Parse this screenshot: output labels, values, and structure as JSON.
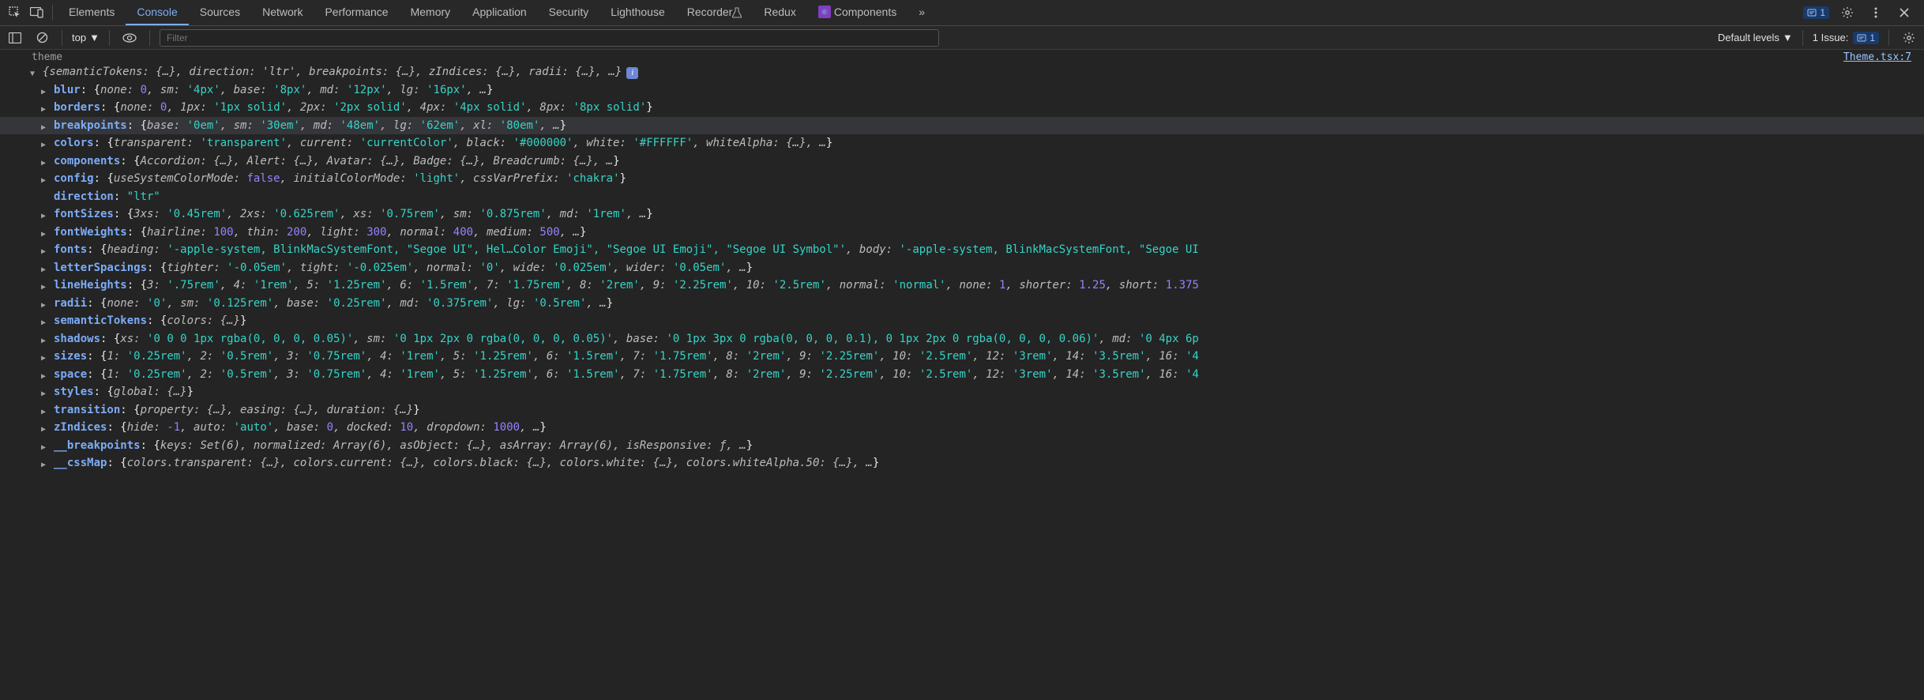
{
  "toolbar": {
    "tabs": [
      "Elements",
      "Console",
      "Sources",
      "Network",
      "Performance",
      "Memory",
      "Application",
      "Security",
      "Lighthouse",
      "Recorder",
      "Redux",
      "Components"
    ],
    "active_tab": "Console",
    "recorder_flask": true,
    "more_tabs_icon": "»",
    "message_count": "1"
  },
  "subbar": {
    "context": "top",
    "filter_placeholder": "Filter",
    "levels": "Default levels",
    "issues_label": "1 Issue:",
    "issues_count": "1"
  },
  "source_link": "Theme.tsx:7",
  "console": {
    "root_label": "theme",
    "summary": "{semanticTokens: {…}, direction: 'ltr', breakpoints: {…}, zIndices: {…}, radii: {…}, …}",
    "entries": [
      {
        "key": "blur",
        "tokens": [
          [
            "p",
            "{"
          ],
          [
            "g",
            "none: "
          ],
          [
            "n",
            "0"
          ],
          [
            "g",
            ", sm: "
          ],
          [
            "s",
            "'4px'"
          ],
          [
            "g",
            ", base: "
          ],
          [
            "s",
            "'8px'"
          ],
          [
            "g",
            ", md: "
          ],
          [
            "s",
            "'12px'"
          ],
          [
            "g",
            ", lg: "
          ],
          [
            "s",
            "'16px'"
          ],
          [
            "g",
            ", …"
          ],
          [
            "p",
            "}"
          ]
        ]
      },
      {
        "key": "borders",
        "tokens": [
          [
            "p",
            "{"
          ],
          [
            "g",
            "none: "
          ],
          [
            "n",
            "0"
          ],
          [
            "g",
            ", 1px: "
          ],
          [
            "s",
            "'1px solid'"
          ],
          [
            "g",
            ", 2px: "
          ],
          [
            "s",
            "'2px solid'"
          ],
          [
            "g",
            ", 4px: "
          ],
          [
            "s",
            "'4px solid'"
          ],
          [
            "g",
            ", 8px: "
          ],
          [
            "s",
            "'8px solid'"
          ],
          [
            "p",
            "}"
          ]
        ]
      },
      {
        "key": "breakpoints",
        "highlight": true,
        "tokens": [
          [
            "p",
            "{"
          ],
          [
            "g",
            "base: "
          ],
          [
            "s",
            "'0em'"
          ],
          [
            "g",
            ", sm: "
          ],
          [
            "s",
            "'30em'"
          ],
          [
            "g",
            ", md: "
          ],
          [
            "s",
            "'48em'"
          ],
          [
            "g",
            ", lg: "
          ],
          [
            "s",
            "'62em'"
          ],
          [
            "g",
            ", xl: "
          ],
          [
            "s",
            "'80em'"
          ],
          [
            "g",
            ", …"
          ],
          [
            "p",
            "}"
          ]
        ]
      },
      {
        "key": "colors",
        "tokens": [
          [
            "p",
            "{"
          ],
          [
            "g",
            "transparent: "
          ],
          [
            "s",
            "'transparent'"
          ],
          [
            "g",
            ", current: "
          ],
          [
            "s",
            "'currentColor'"
          ],
          [
            "g",
            ", black: "
          ],
          [
            "s",
            "'#000000'"
          ],
          [
            "g",
            ", white: "
          ],
          [
            "s",
            "'#FFFFFF'"
          ],
          [
            "g",
            ", whiteAlpha: "
          ],
          [
            "ell",
            "{…}"
          ],
          [
            "g",
            ", …"
          ],
          [
            "p",
            "}"
          ]
        ]
      },
      {
        "key": "components",
        "tokens": [
          [
            "p",
            "{"
          ],
          [
            "g",
            "Accordion: "
          ],
          [
            "ell",
            "{…}"
          ],
          [
            "g",
            ", Alert: "
          ],
          [
            "ell",
            "{…}"
          ],
          [
            "g",
            ", Avatar: "
          ],
          [
            "ell",
            "{…}"
          ],
          [
            "g",
            ", Badge: "
          ],
          [
            "ell",
            "{…}"
          ],
          [
            "g",
            ", Breadcrumb: "
          ],
          [
            "ell",
            "{…}"
          ],
          [
            "g",
            ", …"
          ],
          [
            "p",
            "}"
          ]
        ]
      },
      {
        "key": "config",
        "tokens": [
          [
            "p",
            "{"
          ],
          [
            "g",
            "useSystemColorMode: "
          ],
          [
            "b",
            "false"
          ],
          [
            "g",
            ", initialColorMode: "
          ],
          [
            "s",
            "'light'"
          ],
          [
            "g",
            ", cssVarPrefix: "
          ],
          [
            "s",
            "'chakra'"
          ],
          [
            "p",
            "}"
          ]
        ]
      },
      {
        "key": "direction",
        "noarrow": true,
        "tokens": [
          [
            "s",
            "\"ltr\""
          ]
        ]
      },
      {
        "key": "fontSizes",
        "tokens": [
          [
            "p",
            "{"
          ],
          [
            "g",
            "3xs: "
          ],
          [
            "s",
            "'0.45rem'"
          ],
          [
            "g",
            ", 2xs: "
          ],
          [
            "s",
            "'0.625rem'"
          ],
          [
            "g",
            ", xs: "
          ],
          [
            "s",
            "'0.75rem'"
          ],
          [
            "g",
            ", sm: "
          ],
          [
            "s",
            "'0.875rem'"
          ],
          [
            "g",
            ", md: "
          ],
          [
            "s",
            "'1rem'"
          ],
          [
            "g",
            ", …"
          ],
          [
            "p",
            "}"
          ]
        ]
      },
      {
        "key": "fontWeights",
        "tokens": [
          [
            "p",
            "{"
          ],
          [
            "g",
            "hairline: "
          ],
          [
            "n",
            "100"
          ],
          [
            "g",
            ", thin: "
          ],
          [
            "n",
            "200"
          ],
          [
            "g",
            ", light: "
          ],
          [
            "n",
            "300"
          ],
          [
            "g",
            ", normal: "
          ],
          [
            "n",
            "400"
          ],
          [
            "g",
            ", medium: "
          ],
          [
            "n",
            "500"
          ],
          [
            "g",
            ", …"
          ],
          [
            "p",
            "}"
          ]
        ]
      },
      {
        "key": "fonts",
        "tokens": [
          [
            "p",
            "{"
          ],
          [
            "g",
            "heading: "
          ],
          [
            "s",
            "'-apple-system, BlinkMacSystemFont, \"Segoe UI\", Hel…Color Emoji\", \"Segoe UI Emoji\", \"Segoe UI Symbol\"'"
          ],
          [
            "g",
            ", body: "
          ],
          [
            "s",
            "'-apple-system, BlinkMacSystemFont, \"Segoe UI"
          ]
        ]
      },
      {
        "key": "letterSpacings",
        "tokens": [
          [
            "p",
            "{"
          ],
          [
            "g",
            "tighter: "
          ],
          [
            "s",
            "'-0.05em'"
          ],
          [
            "g",
            ", tight: "
          ],
          [
            "s",
            "'-0.025em'"
          ],
          [
            "g",
            ", normal: "
          ],
          [
            "s",
            "'0'"
          ],
          [
            "g",
            ", wide: "
          ],
          [
            "s",
            "'0.025em'"
          ],
          [
            "g",
            ", wider: "
          ],
          [
            "s",
            "'0.05em'"
          ],
          [
            "g",
            ", …"
          ],
          [
            "p",
            "}"
          ]
        ]
      },
      {
        "key": "lineHeights",
        "tokens": [
          [
            "p",
            "{"
          ],
          [
            "g",
            "3: "
          ],
          [
            "s",
            "'.75rem'"
          ],
          [
            "g",
            ", 4: "
          ],
          [
            "s",
            "'1rem'"
          ],
          [
            "g",
            ", 5: "
          ],
          [
            "s",
            "'1.25rem'"
          ],
          [
            "g",
            ", 6: "
          ],
          [
            "s",
            "'1.5rem'"
          ],
          [
            "g",
            ", 7: "
          ],
          [
            "s",
            "'1.75rem'"
          ],
          [
            "g",
            ", 8: "
          ],
          [
            "s",
            "'2rem'"
          ],
          [
            "g",
            ", 9: "
          ],
          [
            "s",
            "'2.25rem'"
          ],
          [
            "g",
            ", 10: "
          ],
          [
            "s",
            "'2.5rem'"
          ],
          [
            "g",
            ", normal: "
          ],
          [
            "s",
            "'normal'"
          ],
          [
            "g",
            ", none: "
          ],
          [
            "n",
            "1"
          ],
          [
            "g",
            ", shorter: "
          ],
          [
            "n",
            "1.25"
          ],
          [
            "g",
            ", short: "
          ],
          [
            "n",
            "1.375"
          ]
        ]
      },
      {
        "key": "radii",
        "tokens": [
          [
            "p",
            "{"
          ],
          [
            "g",
            "none: "
          ],
          [
            "s",
            "'0'"
          ],
          [
            "g",
            ", sm: "
          ],
          [
            "s",
            "'0.125rem'"
          ],
          [
            "g",
            ", base: "
          ],
          [
            "s",
            "'0.25rem'"
          ],
          [
            "g",
            ", md: "
          ],
          [
            "s",
            "'0.375rem'"
          ],
          [
            "g",
            ", lg: "
          ],
          [
            "s",
            "'0.5rem'"
          ],
          [
            "g",
            ", …"
          ],
          [
            "p",
            "}"
          ]
        ]
      },
      {
        "key": "semanticTokens",
        "tokens": [
          [
            "p",
            "{"
          ],
          [
            "g",
            "colors: "
          ],
          [
            "ell",
            "{…}"
          ],
          [
            "p",
            "}"
          ]
        ]
      },
      {
        "key": "shadows",
        "tokens": [
          [
            "p",
            "{"
          ],
          [
            "g",
            "xs: "
          ],
          [
            "s",
            "'0 0 0 1px rgba(0, 0, 0, 0.05)'"
          ],
          [
            "g",
            ", sm: "
          ],
          [
            "s",
            "'0 1px 2px 0 rgba(0, 0, 0, 0.05)'"
          ],
          [
            "g",
            ", base: "
          ],
          [
            "s",
            "'0 1px 3px 0 rgba(0, 0, 0, 0.1), 0 1px 2px 0 rgba(0, 0, 0, 0.06)'"
          ],
          [
            "g",
            ", md: "
          ],
          [
            "s",
            "'0 4px 6p"
          ]
        ]
      },
      {
        "key": "sizes",
        "tokens": [
          [
            "p",
            "{"
          ],
          [
            "g",
            "1: "
          ],
          [
            "s",
            "'0.25rem'"
          ],
          [
            "g",
            ", 2: "
          ],
          [
            "s",
            "'0.5rem'"
          ],
          [
            "g",
            ", 3: "
          ],
          [
            "s",
            "'0.75rem'"
          ],
          [
            "g",
            ", 4: "
          ],
          [
            "s",
            "'1rem'"
          ],
          [
            "g",
            ", 5: "
          ],
          [
            "s",
            "'1.25rem'"
          ],
          [
            "g",
            ", 6: "
          ],
          [
            "s",
            "'1.5rem'"
          ],
          [
            "g",
            ", 7: "
          ],
          [
            "s",
            "'1.75rem'"
          ],
          [
            "g",
            ", 8: "
          ],
          [
            "s",
            "'2rem'"
          ],
          [
            "g",
            ", 9: "
          ],
          [
            "s",
            "'2.25rem'"
          ],
          [
            "g",
            ", 10: "
          ],
          [
            "s",
            "'2.5rem'"
          ],
          [
            "g",
            ", 12: "
          ],
          [
            "s",
            "'3rem'"
          ],
          [
            "g",
            ", 14: "
          ],
          [
            "s",
            "'3.5rem'"
          ],
          [
            "g",
            ", 16: "
          ],
          [
            "s",
            "'4"
          ]
        ]
      },
      {
        "key": "space",
        "tokens": [
          [
            "p",
            "{"
          ],
          [
            "g",
            "1: "
          ],
          [
            "s",
            "'0.25rem'"
          ],
          [
            "g",
            ", 2: "
          ],
          [
            "s",
            "'0.5rem'"
          ],
          [
            "g",
            ", 3: "
          ],
          [
            "s",
            "'0.75rem'"
          ],
          [
            "g",
            ", 4: "
          ],
          [
            "s",
            "'1rem'"
          ],
          [
            "g",
            ", 5: "
          ],
          [
            "s",
            "'1.25rem'"
          ],
          [
            "g",
            ", 6: "
          ],
          [
            "s",
            "'1.5rem'"
          ],
          [
            "g",
            ", 7: "
          ],
          [
            "s",
            "'1.75rem'"
          ],
          [
            "g",
            ", 8: "
          ],
          [
            "s",
            "'2rem'"
          ],
          [
            "g",
            ", 9: "
          ],
          [
            "s",
            "'2.25rem'"
          ],
          [
            "g",
            ", 10: "
          ],
          [
            "s",
            "'2.5rem'"
          ],
          [
            "g",
            ", 12: "
          ],
          [
            "s",
            "'3rem'"
          ],
          [
            "g",
            ", 14: "
          ],
          [
            "s",
            "'3.5rem'"
          ],
          [
            "g",
            ", 16: "
          ],
          [
            "s",
            "'4"
          ]
        ]
      },
      {
        "key": "styles",
        "tokens": [
          [
            "p",
            "{"
          ],
          [
            "g",
            "global: "
          ],
          [
            "ell",
            "{…}"
          ],
          [
            "p",
            "}"
          ]
        ]
      },
      {
        "key": "transition",
        "tokens": [
          [
            "p",
            "{"
          ],
          [
            "g",
            "property: "
          ],
          [
            "ell",
            "{…}"
          ],
          [
            "g",
            ", easing: "
          ],
          [
            "ell",
            "{…}"
          ],
          [
            "g",
            ", duration: "
          ],
          [
            "ell",
            "{…}"
          ],
          [
            "p",
            "}"
          ]
        ]
      },
      {
        "key": "zIndices",
        "tokens": [
          [
            "p",
            "{"
          ],
          [
            "g",
            "hide: "
          ],
          [
            "n",
            "-1"
          ],
          [
            "g",
            ", auto: "
          ],
          [
            "s",
            "'auto'"
          ],
          [
            "g",
            ", base: "
          ],
          [
            "n",
            "0"
          ],
          [
            "g",
            ", docked: "
          ],
          [
            "n",
            "10"
          ],
          [
            "g",
            ", dropdown: "
          ],
          [
            "n",
            "1000"
          ],
          [
            "g",
            ", …"
          ],
          [
            "p",
            "}"
          ]
        ]
      },
      {
        "key": "__breakpoints",
        "tokens": [
          [
            "p",
            "{"
          ],
          [
            "g",
            "keys: "
          ],
          [
            "fn",
            "Set(6)"
          ],
          [
            "g",
            ", normalized: "
          ],
          [
            "fn",
            "Array(6)"
          ],
          [
            "g",
            ", asObject: "
          ],
          [
            "ell",
            "{…}"
          ],
          [
            "g",
            ", asArray: "
          ],
          [
            "fn",
            "Array(6)"
          ],
          [
            "g",
            ", isResponsive: "
          ],
          [
            "fn",
            "ƒ"
          ],
          [
            "g",
            ", …"
          ],
          [
            "p",
            "}"
          ]
        ]
      },
      {
        "key": "__cssMap",
        "tokens": [
          [
            "p",
            "{"
          ],
          [
            "g",
            "colors.transparent: "
          ],
          [
            "ell",
            "{…}"
          ],
          [
            "g",
            ", colors.current: "
          ],
          [
            "ell",
            "{…}"
          ],
          [
            "g",
            ", colors.black: "
          ],
          [
            "ell",
            "{…}"
          ],
          [
            "g",
            ", colors.white: "
          ],
          [
            "ell",
            "{…}"
          ],
          [
            "g",
            ", colors.whiteAlpha.50: "
          ],
          [
            "ell",
            "{…}"
          ],
          [
            "g",
            ", …"
          ],
          [
            "p",
            "}"
          ]
        ]
      }
    ]
  }
}
